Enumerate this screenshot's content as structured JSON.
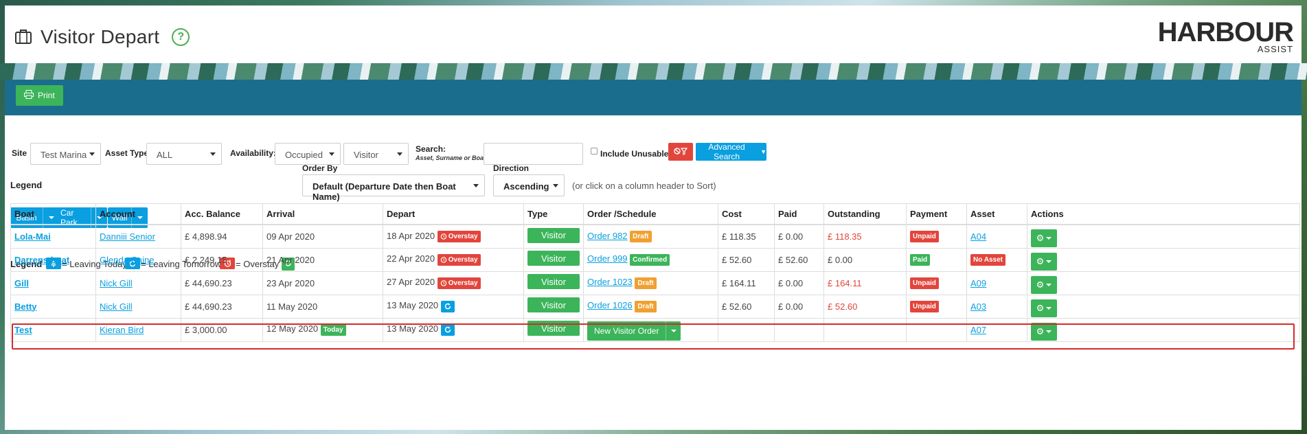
{
  "page": {
    "title": "Visitor Depart",
    "help_glyph": "?"
  },
  "logo": {
    "line1": "HARBOUR",
    "line2": "ASSIST"
  },
  "toolbar": {
    "print_label": "Print"
  },
  "filters": {
    "site_label": "Site",
    "site_value": "Test Marina",
    "asset_type_label": "Asset Type",
    "asset_type_value": "ALL",
    "availability_label": "Availability:",
    "availability_value": "Occupied",
    "availability_value2": "Visitor",
    "search_label": "Search:",
    "search_hint": "Asset, Surname or Boat",
    "search_value": "",
    "include_unusable_label": "Include Unusable",
    "advanced_search_label": "Advanced Search"
  },
  "asset_groups": [
    "Basin",
    "Car Park",
    "Wall"
  ],
  "legend": {
    "label": "Legend",
    "leaving_today": "= Leaving Today",
    "leaving_tomorrow": "= Leaving Tomorrow",
    "overstay": "= Overstay"
  },
  "sort": {
    "order_by_label": "Order By",
    "order_by_value": "Default (Departure Date then Boat Name)",
    "direction_label": "Direction",
    "direction_value": "Ascending",
    "hint": "(or click on a column header to Sort)"
  },
  "table": {
    "headers": [
      "Boat",
      "Account",
      "Acc. Balance",
      "Arrival",
      "Depart",
      "Type",
      "Order /Schedule",
      "Cost",
      "Paid",
      "Outstanding",
      "Payment",
      "Asset",
      "Actions"
    ],
    "rows": [
      {
        "boat": "Lola-Mai",
        "account": "Danniii Senior",
        "balance": "£ 4,898.94",
        "arrival": "09 Apr 2020",
        "arrival_badge": "",
        "depart": "18 Apr 2020",
        "depart_badge": "Overstay",
        "type": "Visitor",
        "order": "Order 982",
        "order_status": "Draft",
        "cost": "£ 118.35",
        "paid": "£ 0.00",
        "outstanding": "£ 118.35",
        "payment": "Unpaid",
        "asset": "A04"
      },
      {
        "boat": "Darrens boat",
        "account": "Glenda Caine",
        "balance": "£ 2,249.15",
        "arrival": "21 Apr 2020",
        "arrival_badge": "",
        "depart": "22 Apr 2020",
        "depart_badge": "Overstay",
        "type": "Visitor",
        "order": "Order 999",
        "order_status": "Confirmed",
        "cost": "£ 52.60",
        "paid": "£ 52.60",
        "outstanding": "£ 0.00",
        "payment": "Paid",
        "asset": "No Asset"
      },
      {
        "boat": "Gill",
        "account": "Nick Gill",
        "balance": "£ 44,690.23",
        "arrival": "23 Apr 2020",
        "arrival_badge": "",
        "depart": "27 Apr 2020",
        "depart_badge": "Overstay",
        "type": "Visitor",
        "order": "Order 1023",
        "order_status": "Draft",
        "cost": "£ 164.11",
        "paid": "£ 0.00",
        "outstanding": "£ 164.11",
        "payment": "Unpaid",
        "asset": "A09"
      },
      {
        "boat": "Betty",
        "account": "Nick Gill",
        "balance": "£ 44,690.23",
        "arrival": "11 May 2020",
        "arrival_badge": "",
        "depart": "13 May 2020",
        "depart_badge": "",
        "type": "Visitor",
        "order": "Order 1026",
        "order_status": "Draft",
        "cost": "£ 52.60",
        "paid": "£ 0.00",
        "outstanding": "£ 52.60",
        "payment": "Unpaid",
        "asset": "A03"
      },
      {
        "boat": "Test",
        "account": "Kieran Bird",
        "balance": "£ 3,000.00",
        "arrival": "12 May 2020",
        "arrival_badge": "Today",
        "depart": "13 May 2020",
        "depart_badge": "",
        "type": "Visitor",
        "order": "",
        "new_order_label": "New Visitor Order",
        "order_status": "",
        "cost": "",
        "paid": "",
        "outstanding": "",
        "payment": "",
        "asset": "A07"
      }
    ]
  },
  "colors": {
    "header_bar": "#1a6d8c",
    "primary": "#0a9fe0",
    "success": "#3cb45a",
    "danger": "#e2453c",
    "warning": "#f0a030",
    "highlight": "#d52b2b"
  }
}
